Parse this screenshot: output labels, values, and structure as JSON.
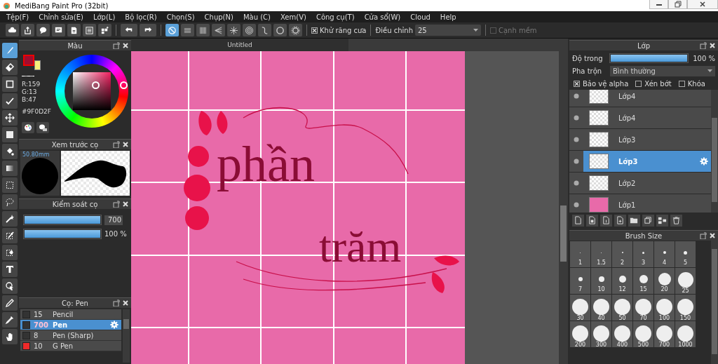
{
  "window": {
    "title": "MediBang Paint Pro (32bit)"
  },
  "menu": [
    "Tệp(F)",
    "Chỉnh sửa(E)",
    "Lớp(L)",
    "Bộ lọc(R)",
    "Chọn(S)",
    "Chụp(N)",
    "Màu (C)",
    "Xem(V)",
    "Công cụ(T)",
    "Cửa sổ(W)",
    "Cloud",
    "Help"
  ],
  "toolbar": {
    "snaps": [
      {
        "selected": true
      },
      {
        "selected": false
      },
      {
        "selected": false
      },
      {
        "selected": false
      },
      {
        "selected": false
      },
      {
        "selected": false
      },
      {
        "selected": false
      },
      {
        "selected": false
      }
    ],
    "antialias": {
      "label": "Khử răng cưa",
      "checked": true
    },
    "adjust": {
      "label": "Điều chỉnh",
      "value": "25"
    },
    "soft_edge": {
      "label": "Cạnh mềm",
      "checked": false,
      "disabled": true
    }
  },
  "tools": [
    {
      "selected": true
    },
    {
      "selected": false
    },
    {
      "selected": false
    },
    {
      "selected": false
    },
    {
      "selected": false
    },
    {
      "selected": false
    },
    {
      "selected": false
    },
    {
      "selected": false
    },
    {
      "selected": false
    },
    {
      "selected": false
    },
    {
      "selected": false
    },
    {
      "selected": false
    },
    {
      "selected": false
    },
    {
      "selected": false
    },
    {
      "selected": false
    },
    {
      "selected": false
    },
    {
      "selected": false
    },
    {
      "selected": false
    }
  ],
  "color_panel": {
    "title": "Màu",
    "swatches": [
      {
        "color": "#9f0d2f"
      },
      {
        "color": "#f5ef7a"
      }
    ],
    "readings": [
      "R:159",
      "G:13",
      "B:47"
    ],
    "hex": "#9F0D2F"
  },
  "brush_preview": {
    "title": "Xem trước cọ",
    "size": "50.80mm"
  },
  "brush_control": {
    "title": "Kiểm soát cọ",
    "sliders": [
      {
        "kind": "field",
        "level": 1,
        "reading": "700"
      },
      {
        "kind": "plain",
        "level": 1,
        "reading": "100 %"
      }
    ]
  },
  "brush_list": {
    "title": "Cọ: Pen",
    "items": [
      {
        "size": "15",
        "name": "Pencil",
        "color": "#333333",
        "selected": false
      },
      {
        "size": "700",
        "name": "Pen",
        "color": "#333333",
        "selected": true
      },
      {
        "size": "8",
        "name": "Pen (Sharp)",
        "color": "#333333",
        "selected": false
      },
      {
        "size": "10",
        "name": "G Pen",
        "color": "#ee2a2a",
        "selected": false
      }
    ]
  },
  "canvas": {
    "tab": "Untitled",
    "words": [
      "phần",
      "trăm"
    ]
  },
  "layer_panel": {
    "title": "Lớp",
    "opacity": {
      "label": "Độ trong",
      "level": 1,
      "reading": "100 %"
    },
    "blend": {
      "label": "Pha trộn",
      "value": "Bình thường"
    },
    "options": [
      {
        "label": "Bảo vệ alpha",
        "checked": true
      },
      {
        "label": "Xén bớt",
        "checked": false
      },
      {
        "label": "Khóa",
        "checked": false
      }
    ],
    "layers": [
      {
        "name": "Lớp4",
        "selected": false
      },
      {
        "name": "Lớp4",
        "selected": false
      },
      {
        "name": "Lớp3",
        "selected": false
      },
      {
        "name": "Lớp3",
        "selected": true
      },
      {
        "name": "Lớp2",
        "selected": false
      },
      {
        "name": "Lớp1",
        "selected": false,
        "color": "#e86aa9"
      }
    ]
  },
  "brush_size": {
    "title": "Brush Size",
    "sizes": [
      "1",
      "1.5",
      "2",
      "3",
      "4",
      "5",
      "7",
      "10",
      "12",
      "15",
      "20",
      "25",
      "30",
      "40",
      "50",
      "70",
      "100",
      "150",
      "200",
      "300",
      "400",
      "500",
      "700",
      "1000"
    ]
  }
}
